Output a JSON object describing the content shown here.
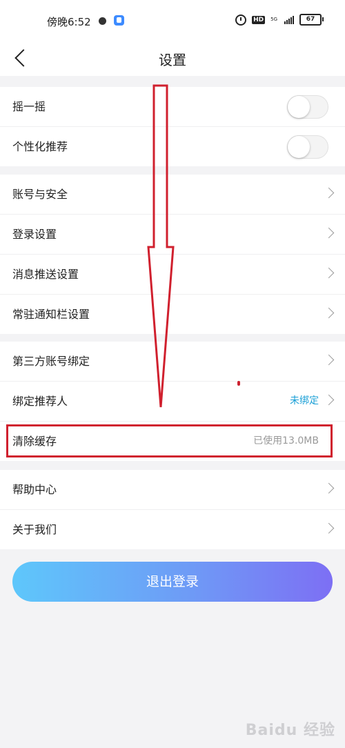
{
  "status": {
    "time": "傍晚6:52",
    "network": "5G",
    "hd": "HD",
    "battery": "67"
  },
  "nav": {
    "title": "设置"
  },
  "toggles": [
    {
      "label": "摇一摇",
      "on": false
    },
    {
      "label": "个性化推荐",
      "on": false
    }
  ],
  "account_section": [
    {
      "label": "账号与安全"
    },
    {
      "label": "登录设置"
    },
    {
      "label": "消息推送设置"
    },
    {
      "label": "常驻通知栏设置"
    }
  ],
  "binding_section": {
    "third_party": "第三方账号绑定",
    "referrer_label": "绑定推荐人",
    "referrer_value": "未绑定",
    "cache_label": "清除缓存",
    "cache_value": "已使用13.0MB"
  },
  "help_section": [
    {
      "label": "帮助中心"
    },
    {
      "label": "关于我们"
    }
  ],
  "logout_label": "退出登录",
  "watermark": "Baidu 经验",
  "colors": {
    "annotation_red": "#d0202e",
    "link_blue": "#1a9fd6",
    "gradient_start": "#5ec7fb",
    "gradient_end": "#7d6ff4"
  }
}
